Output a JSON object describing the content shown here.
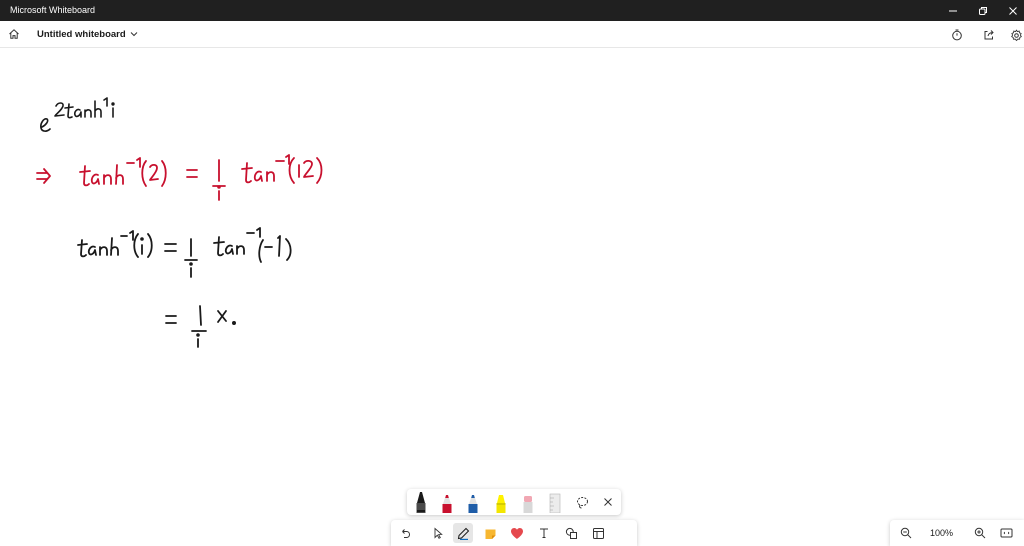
{
  "window": {
    "title": "Microsoft Whiteboard"
  },
  "header": {
    "board_title": "Untitled whiteboard"
  },
  "zoom": {
    "level": "100%"
  },
  "colors": {
    "ink_black": "#1a1a1a",
    "ink_red": "#c8102e",
    "accent": "#0f6cbd"
  },
  "icons": {
    "window": [
      "minimize-icon",
      "restore-icon",
      "close-icon"
    ],
    "header": [
      "home-icon",
      "chevron-down-icon",
      "timer-icon",
      "share-icon",
      "settings-icon"
    ],
    "palette": [
      "black-pen-icon",
      "red-pen-icon",
      "blue-pen-icon",
      "yellow-highlighter-icon",
      "eraser-icon",
      "ruler-icon",
      "lasso-icon",
      "close-icon"
    ],
    "toolbar": [
      "undo-icon",
      "select-icon",
      "pen-icon",
      "sticky-note-icon",
      "reactions-icon",
      "text-icon",
      "shapes-icon",
      "templates-icon"
    ],
    "zoom": [
      "zoom-out-icon",
      "zoom-in-icon",
      "fit-to-screen-icon"
    ]
  }
}
